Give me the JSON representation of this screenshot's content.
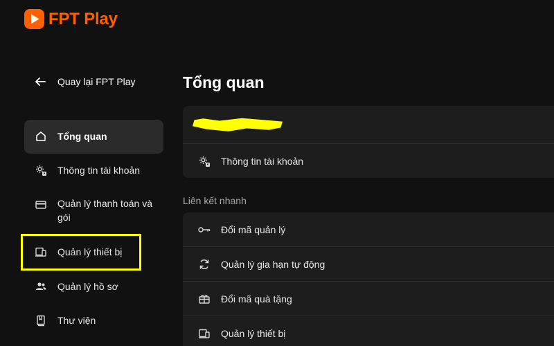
{
  "brand": {
    "name": "FPT Play",
    "color": "#fe5f00"
  },
  "back": {
    "label": "Quay lại FPT Play"
  },
  "sidebar": {
    "items": [
      {
        "label": "Tổng quan",
        "icon": "home-icon",
        "active": true
      },
      {
        "label": "Thông tin tài khoản",
        "icon": "account-gear-icon",
        "active": false
      },
      {
        "label": "Quản lý thanh toán và gói",
        "icon": "credit-card-icon",
        "active": false
      },
      {
        "label": "Quản lý thiết bị",
        "icon": "devices-icon",
        "active": false,
        "highlighted": true
      },
      {
        "label": "Quản lý hồ sơ",
        "icon": "profiles-icon",
        "active": false
      },
      {
        "label": "Thư viện",
        "icon": "library-icon",
        "active": false
      }
    ]
  },
  "main": {
    "title": "Tổng quan",
    "account_card": {
      "account_name_redacted": true,
      "info_label": "Thông tin tài khoản"
    },
    "quick_links": {
      "heading": "Liên kết nhanh",
      "items": [
        {
          "label": "Đổi mã quản lý",
          "icon": "key-icon"
        },
        {
          "label": "Quản lý gia hạn tự động",
          "icon": "refresh-icon"
        },
        {
          "label": "Đổi mã quà tặng",
          "icon": "gift-icon"
        },
        {
          "label": "Quản lý thiết bị",
          "icon": "devices-icon"
        }
      ]
    }
  },
  "colors": {
    "background": "#111111",
    "card": "#1d1d1d",
    "active_item": "#2b2b2b",
    "highlight": "#ffff00"
  }
}
